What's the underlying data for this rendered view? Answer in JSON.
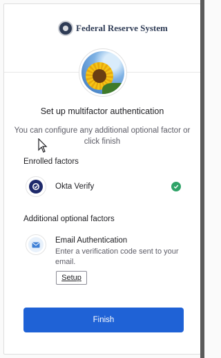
{
  "brand": {
    "name": "Federal Reserve System",
    "logo_icon": "federal-reserve-seal"
  },
  "avatar": {
    "icon": "sunflower-image"
  },
  "heading": {
    "title": "Set up multifactor authentication",
    "subtitle": "You can configure any additional optional factor or click finish"
  },
  "enrolled": {
    "label": "Enrolled factors",
    "factors": [
      {
        "name": "Okta Verify",
        "icon": "okta-verify-icon",
        "status_icon": "check-circle-icon",
        "status_color": "#2fa368"
      }
    ]
  },
  "additional": {
    "label": "Additional optional factors",
    "factors": [
      {
        "name": "Email Authentication",
        "description": "Enter a verification code sent to your email.",
        "icon": "email-icon",
        "action_label": "Setup"
      }
    ]
  },
  "footer": {
    "finish_label": "Finish",
    "accent_color": "#1f62d6"
  }
}
